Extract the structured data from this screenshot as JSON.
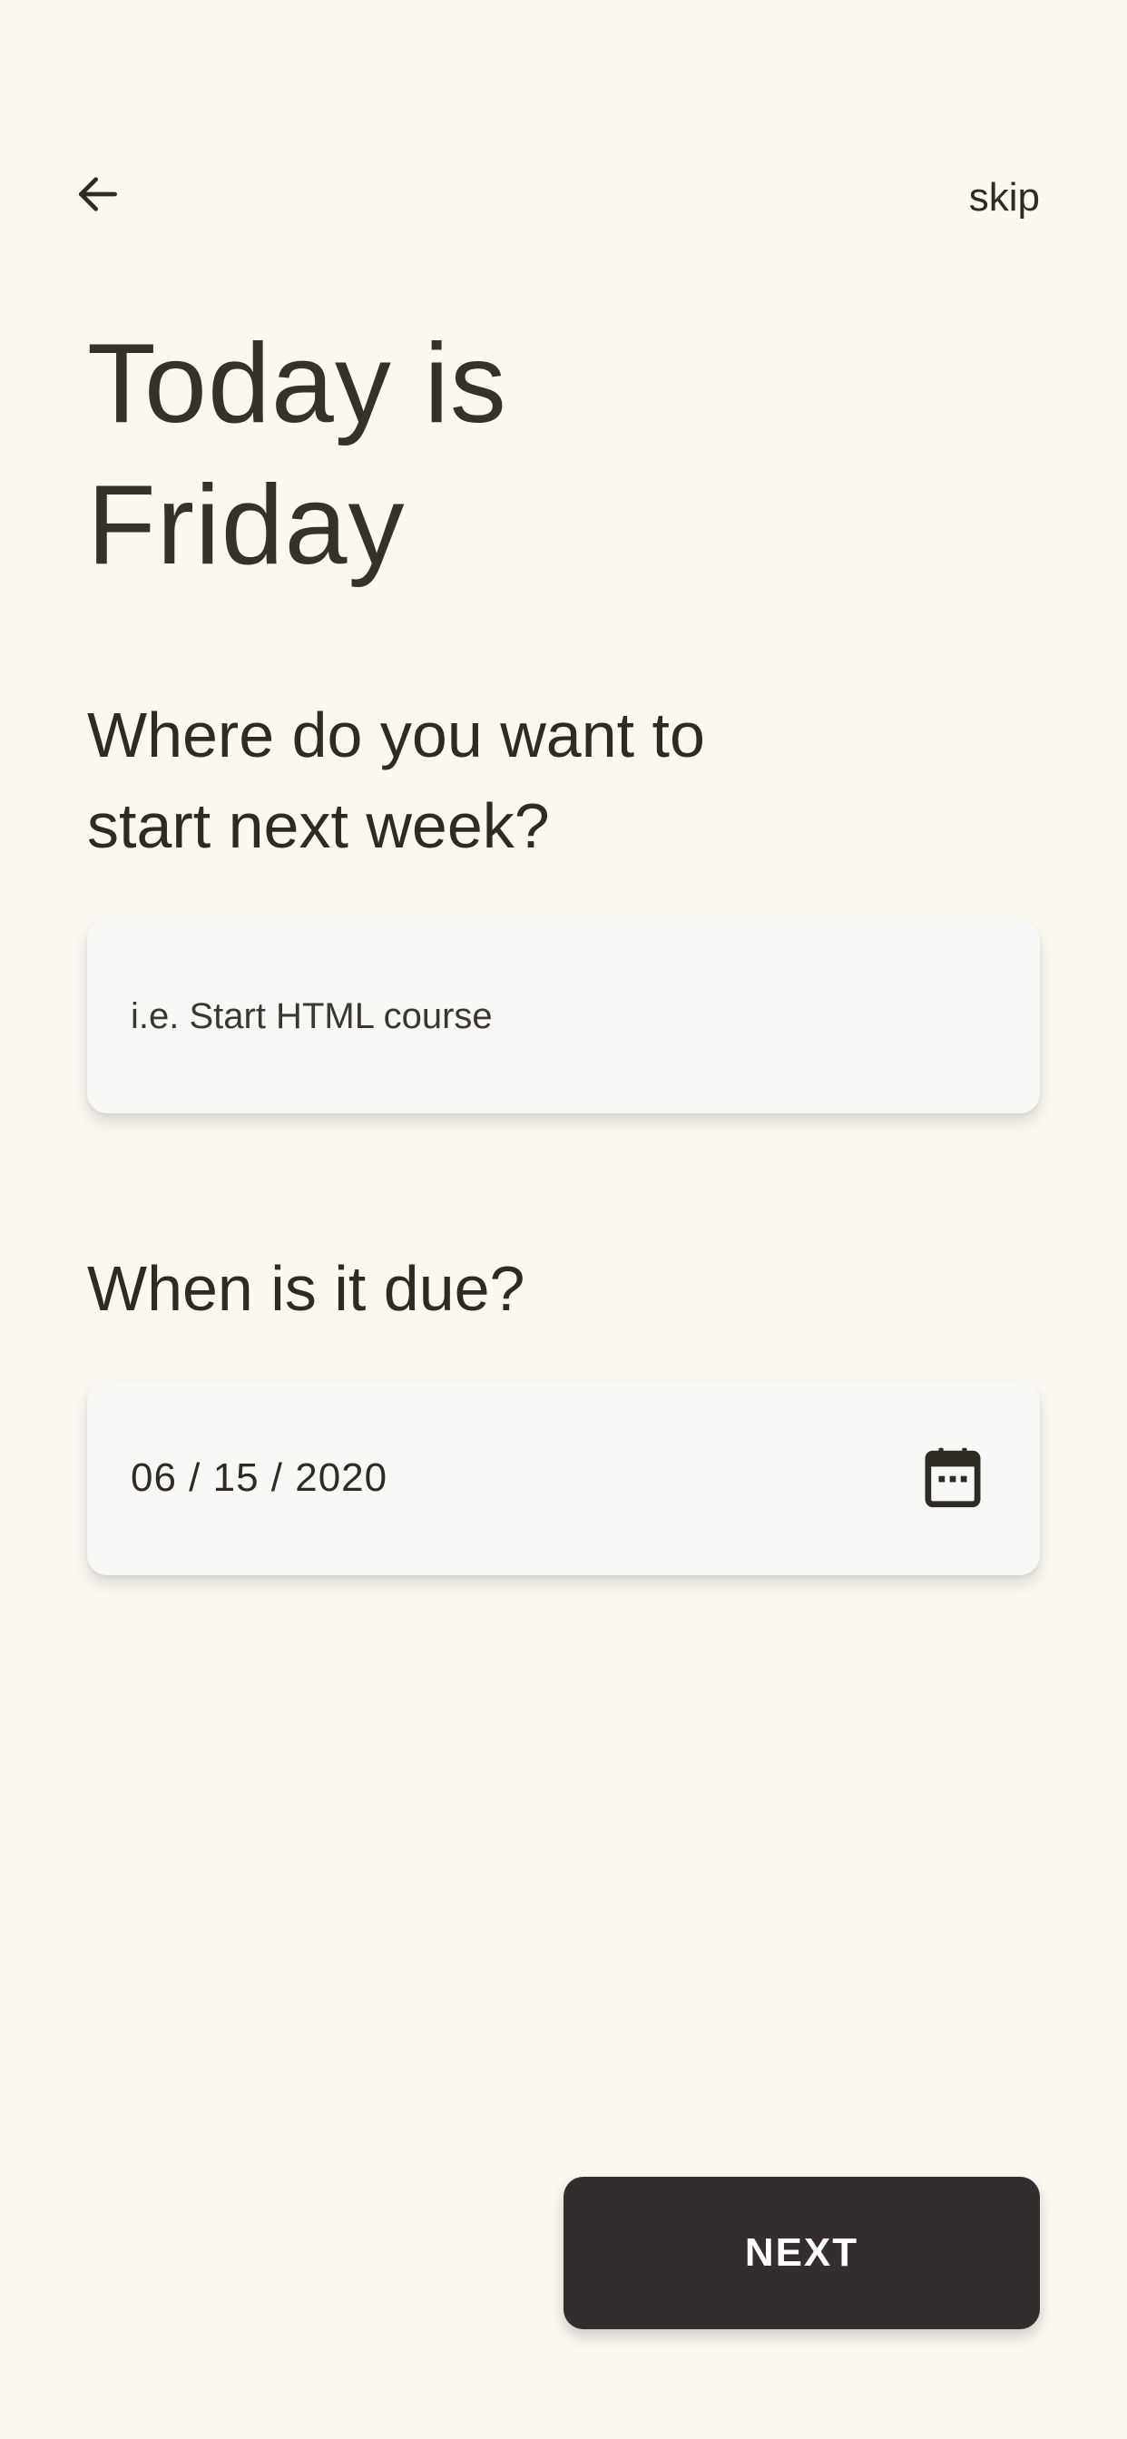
{
  "header": {
    "back_icon": "arrow-left-icon",
    "skip_label": "skip"
  },
  "title": "Today is\nFriday",
  "goal": {
    "question": "Where do you want to\nstart next week?",
    "value": "",
    "placeholder": "i.e. Start HTML course"
  },
  "due": {
    "question": "When is it due?",
    "date_value": "06 / 15 / 2020",
    "calendar_icon": "calendar-icon"
  },
  "footer": {
    "next_label": "NEXT"
  },
  "colors": {
    "background": "#FBF7F1",
    "text": "#2E2B24",
    "field_background": "#F7F7F6",
    "button_background": "#332E2D",
    "button_text": "#FFFFFF"
  }
}
